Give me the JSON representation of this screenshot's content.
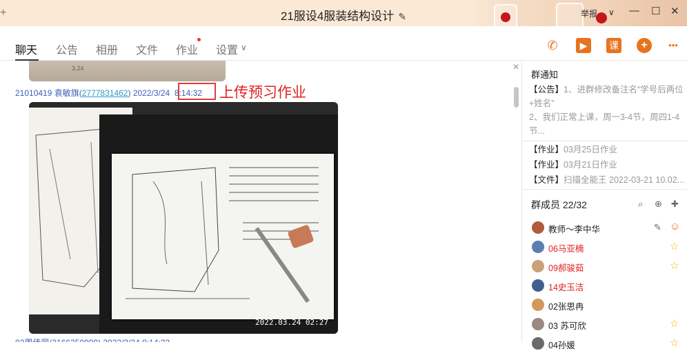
{
  "window": {
    "title": "21服设4服装结构设计",
    "left_glyph": "+",
    "report": "举报",
    "minimize": "—",
    "maximize": "☐",
    "close": "✕"
  },
  "tabs": [
    "聊天",
    "公告",
    "相册",
    "文件",
    "作业",
    "设置"
  ],
  "actions": {
    "phone": "✆",
    "video": "▶",
    "lesson": "课",
    "add": "+",
    "more": "•••"
  },
  "chat": {
    "prev_photo_text": "3.24",
    "message": {
      "sender": "21010419 袁敏旗",
      "qq": "2777831462",
      "date": "2022/3/24",
      "time": "8:14:32"
    },
    "annotation": "上传预习作业",
    "photo_stamp": "2022.03.24 02:27",
    "next_message": "02周佳丽(3166250000) 2022/3/24 8:14:32"
  },
  "side": {
    "notice_title": "群通知",
    "notice_lines": [
      {
        "tag": "【公告】",
        "text": "1、进群修改备注名“学号后两位+姓名”"
      },
      {
        "tag": "",
        "text": "2、我们正常上课，周一3-4节，周四1-4节..."
      },
      {
        "tag": "【作业】",
        "text": "03月25日作业"
      },
      {
        "tag": "【作业】",
        "text": "03月21日作业"
      },
      {
        "tag": "【文件】",
        "text": "扫描全能王 2022-03-21 10.02..."
      }
    ],
    "members_title": "群成员 22/32",
    "members": [
      {
        "name": "教师～李中华",
        "color": "#222222",
        "star": false
      },
      {
        "name": "06马亚楠",
        "color": "#e02020",
        "star": true
      },
      {
        "name": "09郝骏茹",
        "color": "#e02020",
        "star": true
      },
      {
        "name": "14史玉洁",
        "color": "#e02020",
        "star": false
      },
      {
        "name": "02张思冉",
        "color": "#222222",
        "star": false
      },
      {
        "name": "03 苏可欣",
        "color": "#222222",
        "star": true
      },
      {
        "name": "04孙媛",
        "color": "#222222",
        "star": true
      }
    ]
  },
  "colors": {
    "accent": "#e8731f",
    "highlight": "#e02020",
    "link": "#3a5fb8"
  }
}
